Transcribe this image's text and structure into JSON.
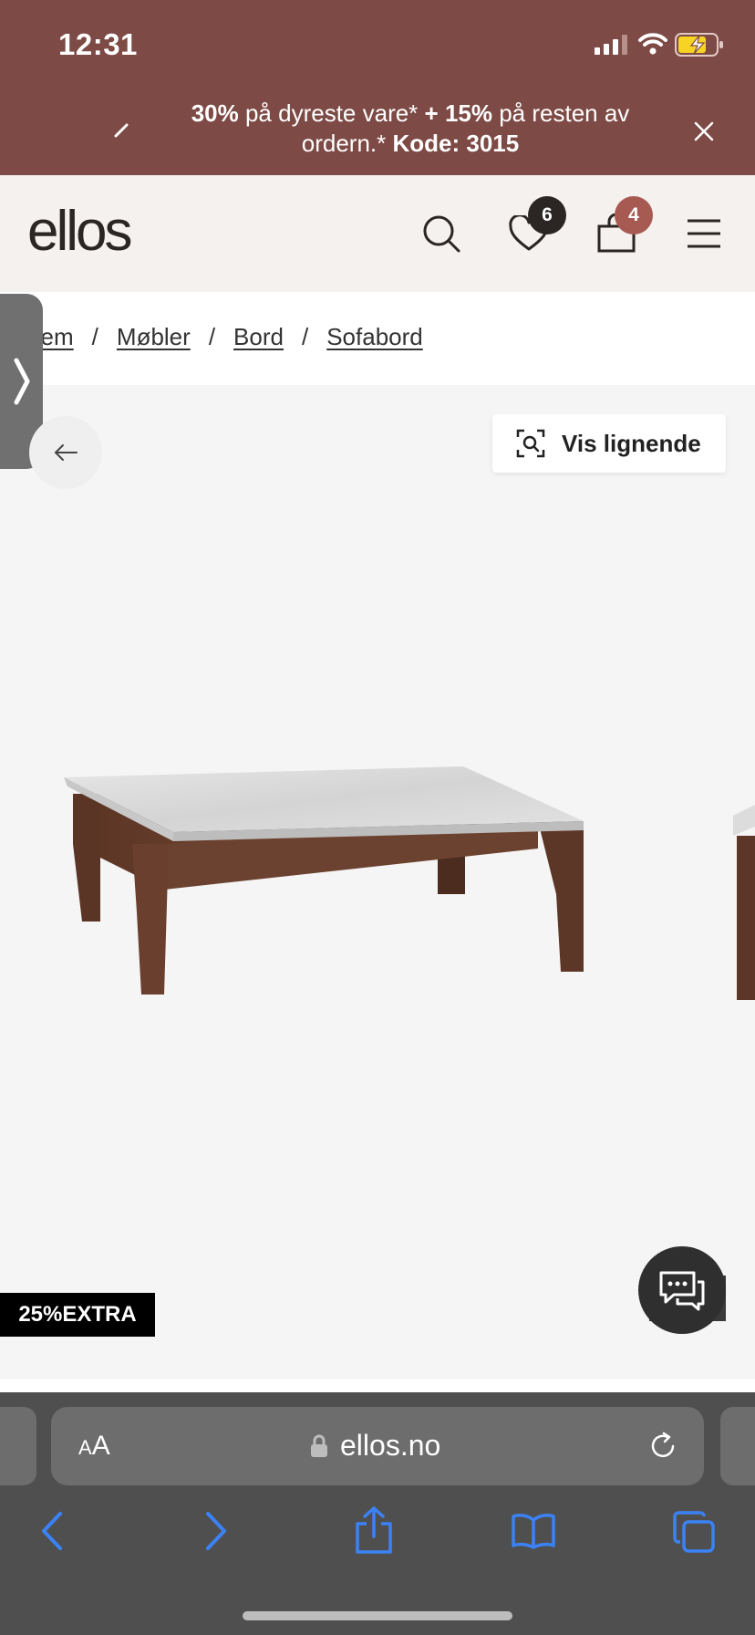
{
  "status": {
    "time": "12:31"
  },
  "promo": {
    "part1_bold": "30%",
    "part2": " på dyreste vare* ",
    "part3_bold": "+ 15%",
    "part4": " på resten av ordern.* ",
    "part5_bold": "Kode: 3015"
  },
  "header": {
    "logo": "ellos",
    "wishlist_count": "6",
    "cart_count": "4"
  },
  "breadcrumb": {
    "items": [
      "Hjem",
      "Møbler",
      "Bord",
      "Sofabord"
    ],
    "separator": "/"
  },
  "gallery": {
    "similar_label": "Vis lignende",
    "promo_tag": "25%EXTRA"
  },
  "browser": {
    "text_size_label": "AA",
    "url": "ellos.no"
  },
  "colors": {
    "promo_bar": "#7d4a45",
    "header_bg": "#f4f1ee",
    "badge_wishlist": "#2b2523",
    "badge_cart": "#a65a52",
    "browser_accent": "#3b82f6"
  },
  "icons": [
    "wifi-icon",
    "battery-icon",
    "signal-icon",
    "close-icon",
    "search-icon",
    "heart-icon",
    "bag-icon",
    "menu-icon",
    "arrow-left-icon",
    "visual-search-icon",
    "chat-icon",
    "lock-icon",
    "reload-icon",
    "back-icon",
    "forward-icon",
    "share-icon",
    "bookmarks-icon",
    "tabs-icon"
  ]
}
